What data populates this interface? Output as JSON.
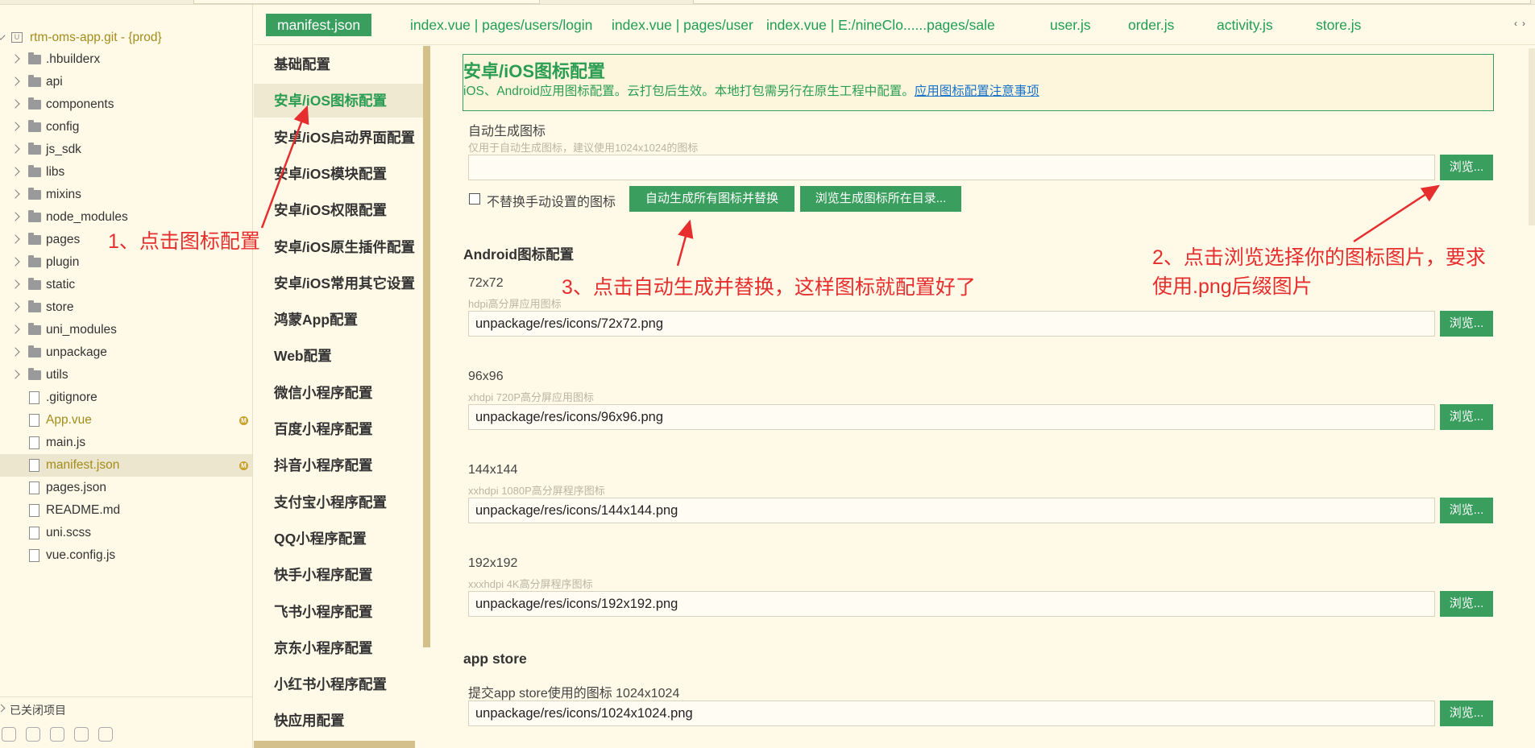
{
  "explorer": {
    "root_label": "rtm-oms-app.git - {prod}",
    "items": [
      {
        "name": ".hbuilderx",
        "type": "folder"
      },
      {
        "name": "api",
        "type": "folder"
      },
      {
        "name": "components",
        "type": "folder"
      },
      {
        "name": "config",
        "type": "folder"
      },
      {
        "name": "js_sdk",
        "type": "folder"
      },
      {
        "name": "libs",
        "type": "folder"
      },
      {
        "name": "mixins",
        "type": "folder"
      },
      {
        "name": "node_modules",
        "type": "folder"
      },
      {
        "name": "pages",
        "type": "folder"
      },
      {
        "name": "plugin",
        "type": "folder"
      },
      {
        "name": "static",
        "type": "folder"
      },
      {
        "name": "store",
        "type": "folder"
      },
      {
        "name": "uni_modules",
        "type": "folder"
      },
      {
        "name": "unpackage",
        "type": "folder"
      },
      {
        "name": "utils",
        "type": "folder"
      },
      {
        "name": ".gitignore",
        "type": "file"
      },
      {
        "name": "App.vue",
        "type": "file",
        "badge": "M"
      },
      {
        "name": "main.js",
        "type": "file"
      },
      {
        "name": "manifest.json",
        "type": "file",
        "badge": "M",
        "selected": true
      },
      {
        "name": "pages.json",
        "type": "file"
      },
      {
        "name": "README.md",
        "type": "file"
      },
      {
        "name": "uni.scss",
        "type": "file"
      },
      {
        "name": "vue.config.js",
        "type": "file"
      }
    ],
    "closed_projects_label": "已关闭项目"
  },
  "tabs": [
    {
      "label": "manifest.json",
      "active": true
    },
    {
      "label": "index.vue | pages/users/login"
    },
    {
      "label": "index.vue | pages/user"
    },
    {
      "label": "index.vue | E:/nineClo......pages/sale"
    },
    {
      "label": "user.js"
    },
    {
      "label": "order.js"
    },
    {
      "label": "activity.js"
    },
    {
      "label": "store.js"
    }
  ],
  "tab_arrows": "‹›",
  "nav": {
    "items": [
      "基础配置",
      "安卓/iOS图标配置",
      "安卓/iOS启动界面配置",
      "安卓/iOS模块配置",
      "安卓/iOS权限配置",
      "安卓/iOS原生插件配置",
      "安卓/iOS常用其它设置",
      "鸿蒙App配置",
      "Web配置",
      "微信小程序配置",
      "百度小程序配置",
      "抖音小程序配置",
      "支付宝小程序配置",
      "QQ小程序配置",
      "快手小程序配置",
      "飞书小程序配置",
      "京东小程序配置",
      "小红书小程序配置",
      "快应用配置"
    ],
    "active_index": 1
  },
  "main": {
    "title": "安卓/iOS图标配置",
    "description": "iOS、Android应用图标配置。云打包后生效。本地打包需另行在原生工程中配置。",
    "description_link": "应用图标配置注意事项",
    "auto_label": "自动生成图标",
    "auto_hint": "仅用于自动生成图标，建议使用1024x1024的图标",
    "auto_value": "",
    "browse_label": "浏览...",
    "checkbox_label": "不替换手动设置的图标",
    "auto_generate_button": "自动生成所有图标并替换",
    "browse_dir_button": "浏览生成图标所在目录...",
    "android_section": "Android图标配置",
    "icons": [
      {
        "size": "72x72",
        "hint": "hdpi高分屏应用图标",
        "value": "unpackage/res/icons/72x72.png"
      },
      {
        "size": "96x96",
        "hint": "xhdpi 720P高分屏应用图标",
        "value": "unpackage/res/icons/96x96.png"
      },
      {
        "size": "144x144",
        "hint": "xxhdpi 1080P高分屏程序图标",
        "value": "unpackage/res/icons/144x144.png"
      },
      {
        "size": "192x192",
        "hint": "xxxhdpi 4K高分屏程序图标",
        "value": "unpackage/res/icons/192x192.png"
      }
    ],
    "appstore_section": "app store",
    "appstore_label": "提交app store使用的图标 1024x1024",
    "appstore_value": "unpackage/res/icons/1024x1024.png"
  },
  "annotations": {
    "step1": "1、点击图标配置",
    "step2_line1": "2、点击浏览选择你的图标图片，要求",
    "step2_line2": "使用.png后缀图片",
    "step3": "3、点击自动生成并替换，这样图标就配置好了"
  },
  "colors": {
    "accent_green": "#3a9e5e",
    "annotation_red": "#e62e2e",
    "background": "#fffae8"
  }
}
